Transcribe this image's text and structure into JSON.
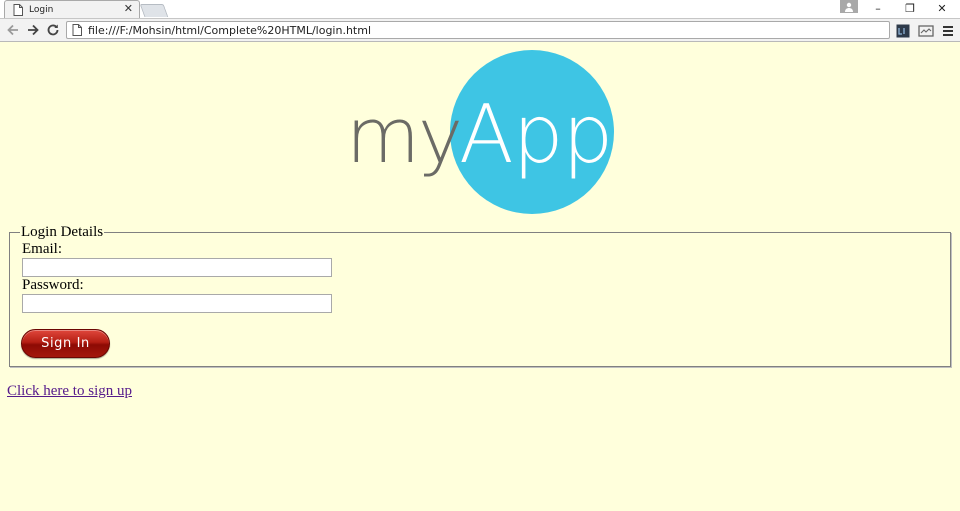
{
  "browser": {
    "tab": {
      "title": "Login",
      "icon": "page-icon",
      "close": "✕"
    },
    "new_tab_icon": "new-tab-icon",
    "window_controls": {
      "user": "user-icon",
      "minimize": "–",
      "restore": "❐",
      "close": "✕"
    },
    "nav": {
      "back": "back-icon",
      "forward": "forward-icon",
      "reload": "reload-icon"
    },
    "address": {
      "url": "file:///F:/Mohsin/html/Complete%20HTML/login.html",
      "icon": "page-icon"
    },
    "extensions": [
      "extension-icon",
      "cast-icon",
      "menu-icon"
    ]
  },
  "page": {
    "background": "#ffffdc",
    "logo": {
      "text_dark": "my",
      "text_light": "App",
      "circle_color": "#3ec5e4",
      "text_dark_color": "#6b6b66"
    },
    "form": {
      "legend": "Login Details",
      "email_label": "Email:",
      "email_value": "",
      "password_label": "Password:",
      "password_value": "",
      "submit_label": "Sign In",
      "submit_color": "#b51f14"
    },
    "signup_link": "Click here to sign up",
    "link_color": "#551a8b"
  }
}
